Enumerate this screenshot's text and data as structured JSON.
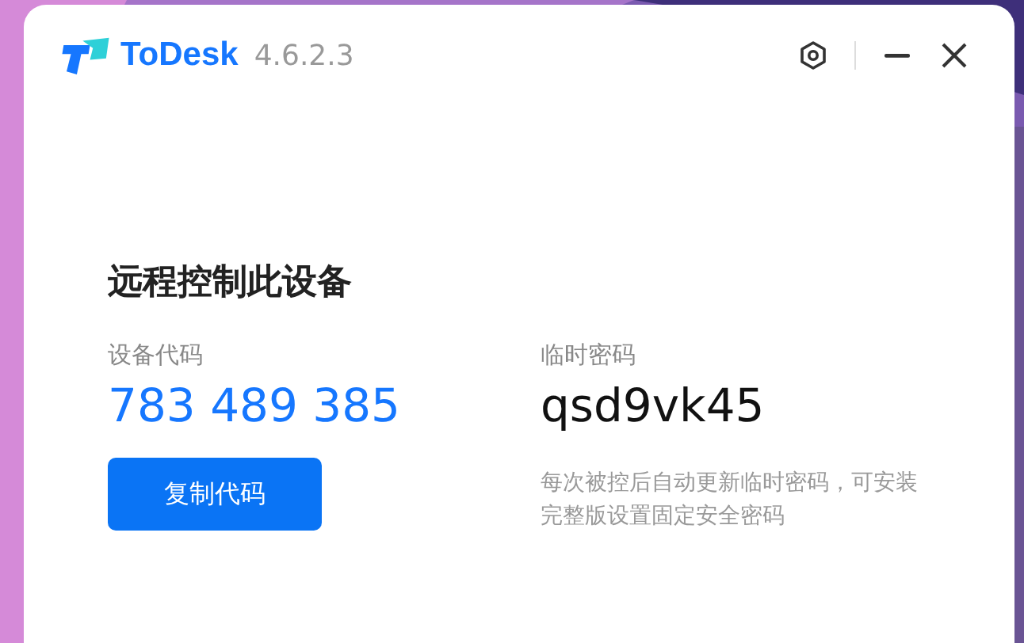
{
  "app": {
    "name": "ToDesk",
    "version": "4.6.2.3"
  },
  "remote": {
    "title": "远程控制此设备",
    "device_code": {
      "label": "设备代码",
      "value": "783 489 385"
    },
    "temp_password": {
      "label": "临时密码",
      "value": "qsd9vk45"
    },
    "copy_button": "复制代码",
    "hint": "每次被控后自动更新临时密码，可安装完整版设置固定安全密码"
  }
}
